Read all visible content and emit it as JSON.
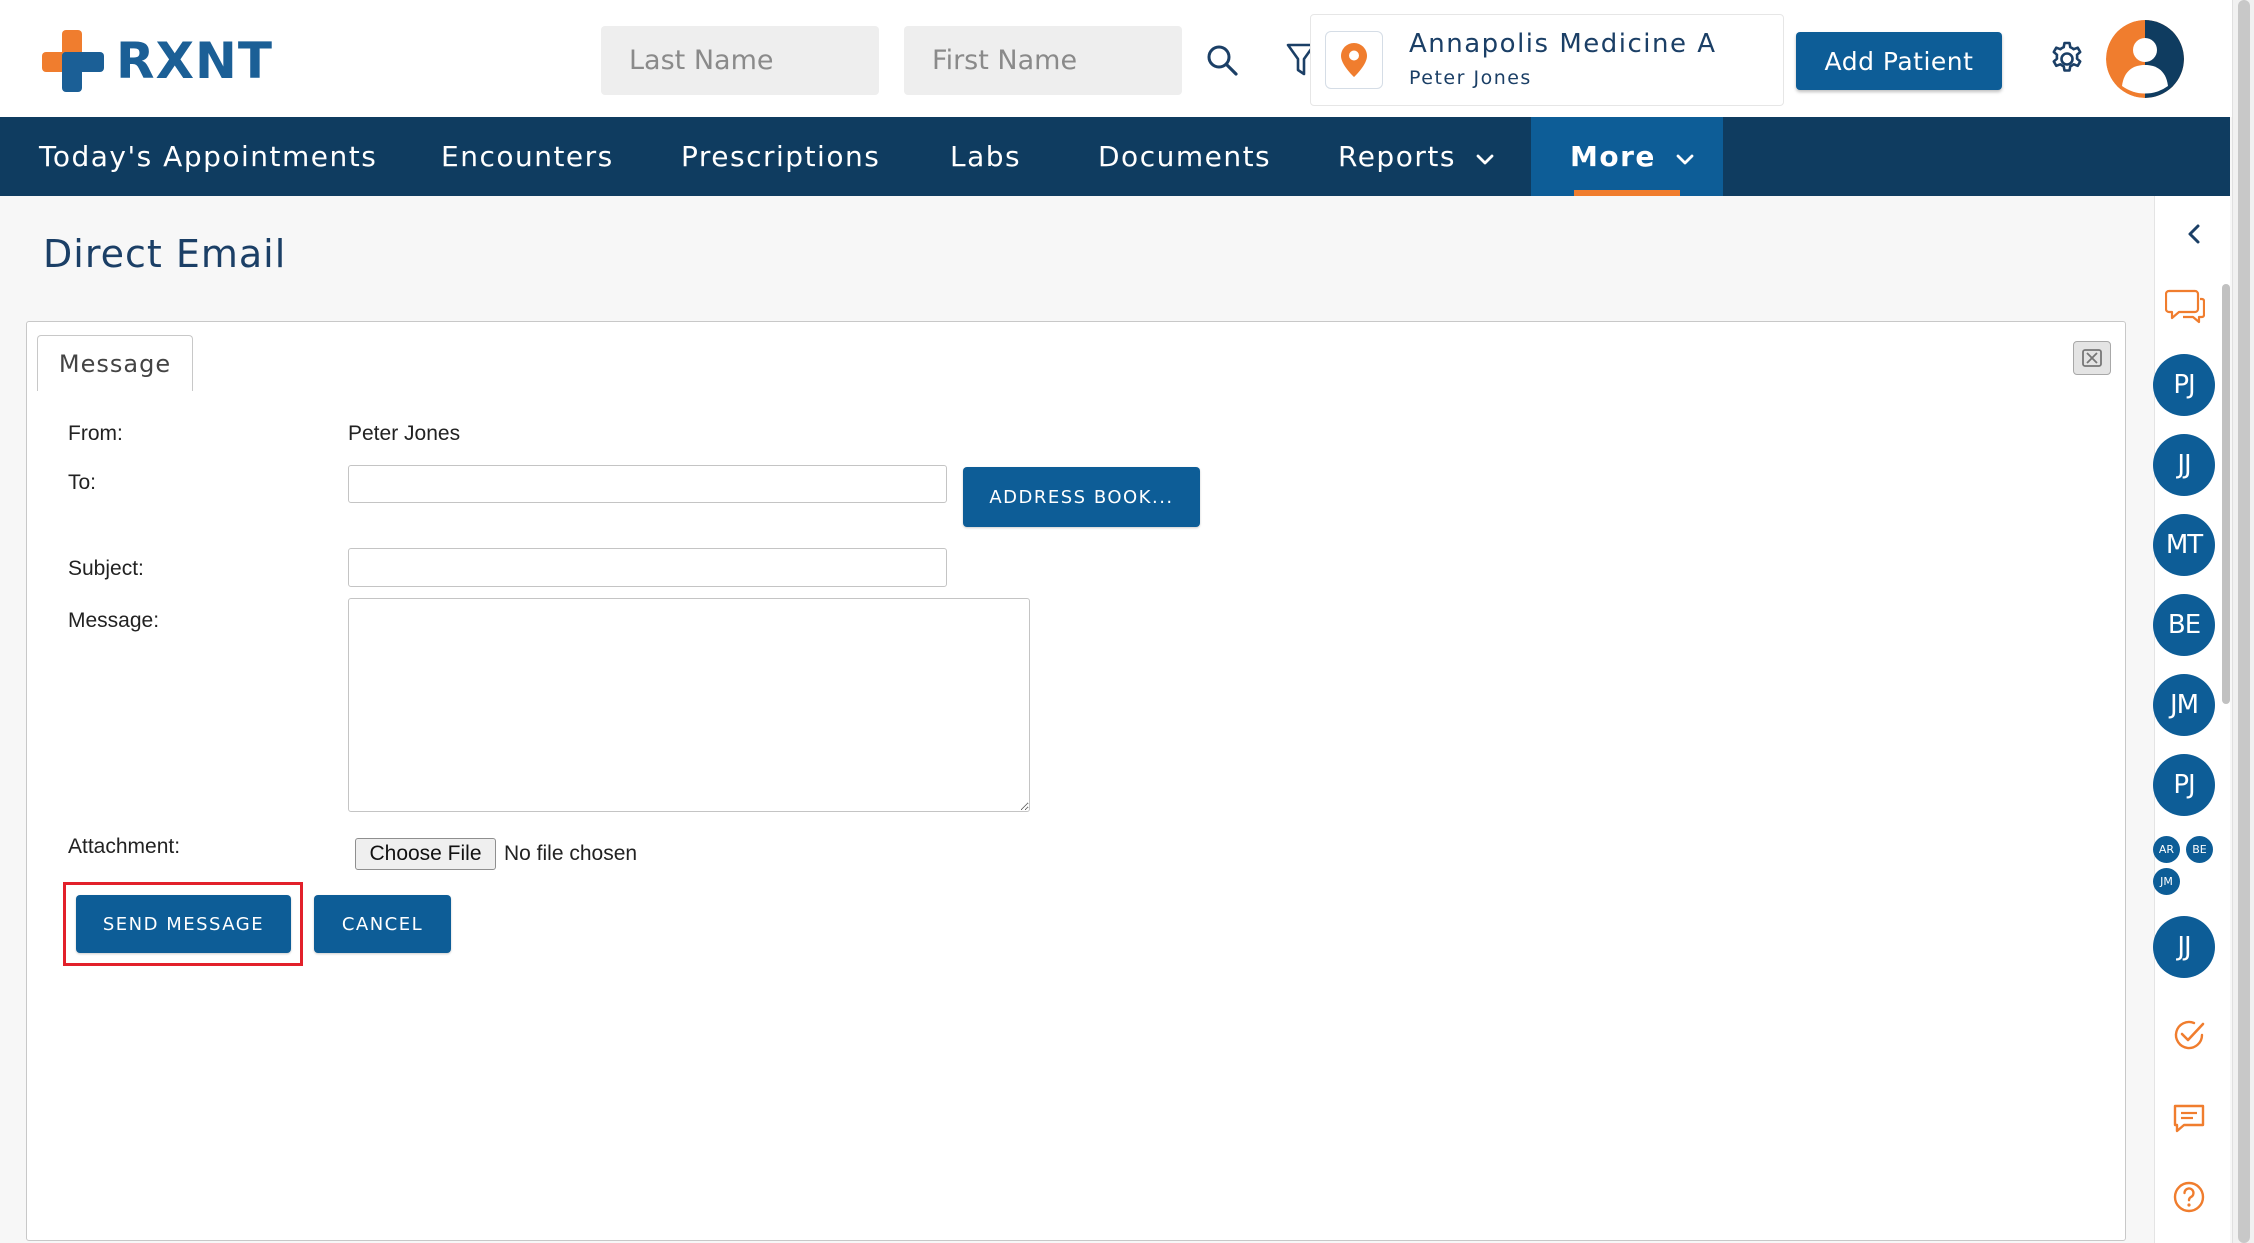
{
  "header": {
    "logo_text": "RXNT",
    "last_name_placeholder": "Last Name",
    "first_name_placeholder": "First Name",
    "location_name": "Annapolis Medicine A",
    "location_user": "Peter Jones",
    "add_patient_label": "Add Patient"
  },
  "nav": {
    "items": [
      {
        "label": "Today's Appointments"
      },
      {
        "label": "Encounters"
      },
      {
        "label": "Prescriptions"
      },
      {
        "label": "Labs"
      },
      {
        "label": "Documents"
      },
      {
        "label": "Reports"
      },
      {
        "label": "More"
      }
    ]
  },
  "page": {
    "title": "Direct Email"
  },
  "form": {
    "tab_label": "Message",
    "from_label": "From:",
    "from_value": "Peter Jones",
    "to_label": "To:",
    "to_value": "",
    "address_book_label": "ADDRESS BOOK...",
    "subject_label": "Subject:",
    "subject_value": "",
    "message_label": "Message:",
    "message_value": "",
    "attachment_label": "Attachment:",
    "choose_file_label": "Choose File",
    "no_file_text": "No file chosen",
    "send_label": "SEND MESSAGE",
    "cancel_label": "CANCEL"
  },
  "sidebar": {
    "people": [
      "PJ",
      "JJ",
      "MT",
      "BE",
      "JM",
      "PJ"
    ],
    "group": [
      "AR",
      "BE",
      "JM"
    ],
    "last_person": "JJ"
  },
  "colors": {
    "brand_blue": "#0d5d97",
    "nav_dark": "#0f3c60",
    "accent_orange": "#f07d2e",
    "highlight_red": "#e2202a"
  }
}
